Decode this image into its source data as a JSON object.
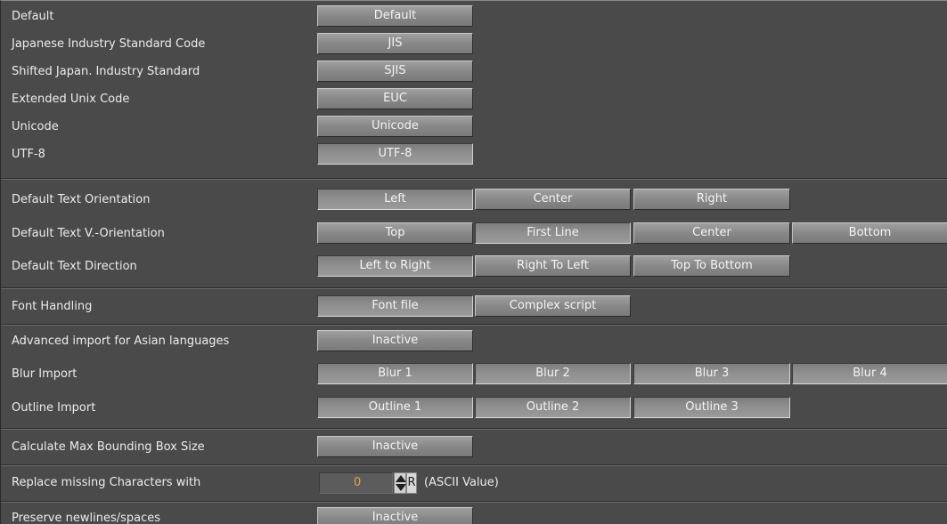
{
  "encoding": {
    "rows": [
      {
        "label": "Default",
        "button": "Default"
      },
      {
        "label": "Japanese Industry Standard Code",
        "button": "JIS"
      },
      {
        "label": "Shifted Japan. Industry Standard",
        "button": "SJIS"
      },
      {
        "label": "Extended Unix Code",
        "button": "EUC"
      },
      {
        "label": "Unicode",
        "button": "Unicode"
      },
      {
        "label": "UTF-8",
        "button": "UTF-8",
        "selected": true
      }
    ]
  },
  "orientation": {
    "text_orientation": {
      "label": "Default Text Orientation",
      "options": [
        "Left",
        "Center",
        "Right"
      ],
      "selected": "Left"
    },
    "text_v_orientation": {
      "label": "Default Text V.-Orientation",
      "options": [
        "Top",
        "First Line",
        "Center",
        "Bottom"
      ],
      "selected": "First Line"
    },
    "text_direction": {
      "label": "Default Text Direction",
      "options": [
        "Left to Right",
        "Right To Left",
        "Top To Bottom"
      ],
      "selected": "Left to Right"
    }
  },
  "font_handling": {
    "label": "Font Handling",
    "options": [
      "Font file",
      "Complex script"
    ],
    "selected": "Font file"
  },
  "import": {
    "asian": {
      "label": "Advanced import for Asian languages",
      "button": "Inactive"
    },
    "blur": {
      "label": "Blur Import",
      "options": [
        "Blur 1",
        "Blur 2",
        "Blur 3",
        "Blur 4"
      ]
    },
    "outline": {
      "label": "Outline Import",
      "options": [
        "Outline 1",
        "Outline 2",
        "Outline 3"
      ]
    }
  },
  "misc": {
    "bounding_box": {
      "label": "Calculate Max Bounding Box Size",
      "button": "Inactive"
    },
    "replace_missing": {
      "label": "Replace missing Characters with",
      "value": "0",
      "reset_label": "R",
      "suffix": "(ASCII Value)"
    },
    "preserve_newlines": {
      "label": "Preserve newlines/spaces",
      "button": "Inactive"
    }
  },
  "colors": {
    "background": "#4a4a4a",
    "button": "#888888",
    "value_text": "#f0a030"
  }
}
